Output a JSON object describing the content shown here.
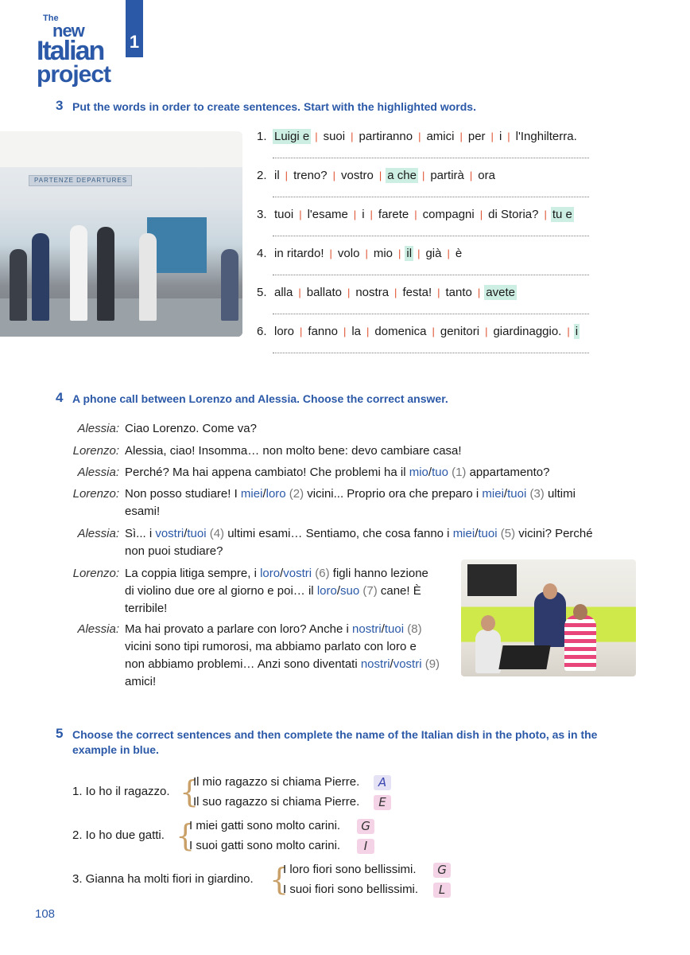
{
  "logo": {
    "line1": "The",
    "line2": "new",
    "line3": "Italian",
    "line4": "project"
  },
  "unit": "1",
  "ex3": {
    "number": "3",
    "title": "Put the words in order to create sentences. Start with the highlighted words.",
    "items": [
      {
        "n": "1.",
        "words": [
          {
            "t": "Luigi e",
            "hl": true
          },
          {
            "t": "suoi"
          },
          {
            "t": "partiranno"
          },
          {
            "t": "amici"
          },
          {
            "t": "per"
          },
          {
            "t": "i"
          },
          {
            "t": "l'Inghilterra."
          }
        ]
      },
      {
        "n": "2.",
        "words": [
          {
            "t": "il"
          },
          {
            "t": "treno?"
          },
          {
            "t": "vostro"
          },
          {
            "t": "a che",
            "hl": true
          },
          {
            "t": "partirà"
          },
          {
            "t": "ora"
          }
        ]
      },
      {
        "n": "3.",
        "words": [
          {
            "t": "tuoi"
          },
          {
            "t": "l'esame"
          },
          {
            "t": "i"
          },
          {
            "t": "farete"
          },
          {
            "t": "compagni"
          },
          {
            "t": "di Storia?"
          },
          {
            "t": "tu e",
            "hl": true
          }
        ]
      },
      {
        "n": "4.",
        "words": [
          {
            "t": "in ritardo!"
          },
          {
            "t": "volo"
          },
          {
            "t": "mio"
          },
          {
            "t": "il",
            "hl": true
          },
          {
            "t": "già"
          },
          {
            "t": "è"
          }
        ]
      },
      {
        "n": "5.",
        "words": [
          {
            "t": "alla"
          },
          {
            "t": "ballato"
          },
          {
            "t": "nostra"
          },
          {
            "t": "festa!"
          },
          {
            "t": "tanto"
          },
          {
            "t": "avete",
            "hl": true
          }
        ]
      },
      {
        "n": "6.",
        "words": [
          {
            "t": "loro"
          },
          {
            "t": "fanno"
          },
          {
            "t": "la"
          },
          {
            "t": "domenica"
          },
          {
            "t": "genitori"
          },
          {
            "t": "giardinaggio."
          },
          {
            "t": "i",
            "hl": true
          }
        ]
      }
    ],
    "photo_sign": "PARTENZE   DEPARTURES"
  },
  "ex4": {
    "number": "4",
    "title": "A phone call between Lorenzo and Alessia. Choose the correct answer.",
    "lines": [
      {
        "speaker": "Alessia:",
        "parts": [
          {
            "t": "Ciao Lorenzo. Come va?"
          }
        ]
      },
      {
        "speaker": "Lorenzo:",
        "parts": [
          {
            "t": "Alessia, ciao! Insomma… non molto bene: devo cambiare casa!"
          }
        ]
      },
      {
        "speaker": "Alessia:",
        "parts": [
          {
            "t": "Perché? Ma hai appena cambiato! Che problemi ha il "
          },
          {
            "t": "mio",
            "c": "opt"
          },
          {
            "t": "/"
          },
          {
            "t": "tuo",
            "c": "opt"
          },
          {
            "t": " (1)",
            "c": "paren"
          },
          {
            "t": " appartamento?"
          }
        ]
      },
      {
        "speaker": "Lorenzo:",
        "parts": [
          {
            "t": "Non posso studiare! I "
          },
          {
            "t": "miei",
            "c": "opt"
          },
          {
            "t": "/"
          },
          {
            "t": "loro",
            "c": "opt"
          },
          {
            "t": " (2)",
            "c": "paren"
          },
          {
            "t": " vicini... Proprio ora che preparo i "
          },
          {
            "t": "miei",
            "c": "opt"
          },
          {
            "t": "/"
          },
          {
            "t": "tuoi",
            "c": "opt"
          },
          {
            "t": " (3)",
            "c": "paren"
          },
          {
            "t": " ultimi"
          }
        ],
        "cont": [
          {
            "t": "esami!"
          }
        ]
      },
      {
        "speaker": "Alessia:",
        "parts": [
          {
            "t": "Sì... i "
          },
          {
            "t": "vostri",
            "c": "opt"
          },
          {
            "t": "/"
          },
          {
            "t": "tuoi",
            "c": "opt"
          },
          {
            "t": " (4)",
            "c": "paren"
          },
          {
            "t": " ultimi esami… Sentiamo, che cosa fanno i "
          },
          {
            "t": "miei",
            "c": "opt"
          },
          {
            "t": "/"
          },
          {
            "t": "tuoi",
            "c": "opt"
          },
          {
            "t": " (5)",
            "c": "paren"
          },
          {
            "t": " vicini? Perché"
          }
        ],
        "cont": [
          {
            "t": "non puoi studiare?"
          }
        ]
      },
      {
        "speaker": "Lorenzo:",
        "parts": [
          {
            "t": "La coppia litiga sempre, i "
          },
          {
            "t": "loro",
            "c": "opt"
          },
          {
            "t": "/"
          },
          {
            "t": "vostri",
            "c": "opt"
          },
          {
            "t": " (6)",
            "c": "paren"
          },
          {
            "t": " figli hanno lezione"
          }
        ],
        "cont": [
          {
            "t": "di violino due ore al giorno e poi… il "
          },
          {
            "t": "loro",
            "c": "opt"
          },
          {
            "t": "/"
          },
          {
            "t": "suo",
            "c": "opt"
          },
          {
            "t": " (7)",
            "c": "paren"
          },
          {
            "t": " cane! È"
          }
        ],
        "cont2": [
          {
            "t": "terribile!"
          }
        ]
      },
      {
        "speaker": "Alessia:",
        "parts": [
          {
            "t": "Ma hai provato a parlare con loro? Anche i "
          },
          {
            "t": "nostri",
            "c": "opt"
          },
          {
            "t": "/"
          },
          {
            "t": "tuoi",
            "c": "opt"
          },
          {
            "t": " (8)",
            "c": "paren"
          }
        ],
        "cont": [
          {
            "t": "vicini sono tipi rumorosi, ma abbiamo parlato con loro e"
          }
        ],
        "cont2": [
          {
            "t": "non abbiamo problemi… Anzi sono diventati "
          },
          {
            "t": "nostri",
            "c": "opt"
          },
          {
            "t": "/"
          },
          {
            "t": "vostri",
            "c": "opt"
          },
          {
            "t": " (9)",
            "c": "paren"
          }
        ],
        "cont3": [
          {
            "t": "amici!"
          }
        ]
      }
    ]
  },
  "ex5": {
    "number": "5",
    "title_line1": "Choose the correct sentences and then complete the name of the Italian dish in the photo, as in the",
    "title_line2": "example in blue.",
    "items": [
      {
        "prompt": "1.  Io ho il ragazzo.",
        "a": "Il mio ragazzo si chiama Pierre.",
        "a_letter": "A",
        "b": "Il suo ragazzo si chiama Pierre.",
        "b_letter": "E"
      },
      {
        "prompt": "2.  Io ho due gatti.",
        "a": "I miei gatti sono molto carini.",
        "a_letter": "G",
        "b": "I suoi gatti sono molto carini.",
        "b_letter": "I"
      },
      {
        "prompt": "3.  Gianna ha molti fiori in giardino.",
        "a": "I loro fiori sono bellissimi.",
        "a_letter": "G",
        "b": "I suoi fiori sono bellissimi.",
        "b_letter": "L"
      }
    ]
  },
  "page_number": "108",
  "colors": {
    "accent": "#2b59a8",
    "highlight": "#cdeee2",
    "separator": "#e0502e",
    "brace": "#c9a067",
    "letter_blue_bg": "#e4e2f4",
    "letter_pink_bg": "#f5d3e6"
  }
}
